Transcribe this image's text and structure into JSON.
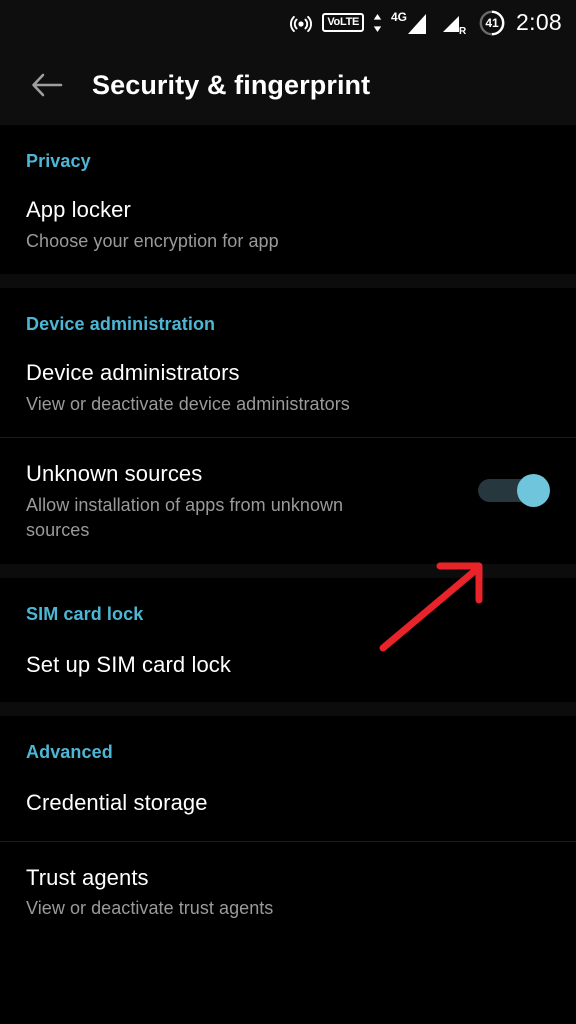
{
  "status_bar": {
    "icons": [
      "hotspot-icon",
      "volte-icon",
      "data-transfer-icon",
      "signal-4g-icon",
      "signal-roaming-icon",
      "battery-icon"
    ],
    "volte_label": "VoLTE",
    "network_label": "4G",
    "roaming_label": "R",
    "battery_level": "41",
    "time": "2:08"
  },
  "app_bar": {
    "back_icon": "back-arrow-icon",
    "title": "Security & fingerprint"
  },
  "colors": {
    "accent": "#4db6d4",
    "background": "#000000",
    "bar_background": "#0e0e0e",
    "primary_text": "#ffffff",
    "secondary_text": "#9a9a9a",
    "toggle_track_on": "#26383d",
    "toggle_thumb_on": "#6fc5dc",
    "annotation": "#e8232a"
  },
  "sections": [
    {
      "header": "Privacy",
      "rows": [
        {
          "title": "App locker",
          "subtitle": "Choose your encryption for app",
          "control": "none"
        }
      ]
    },
    {
      "header": "Device administration",
      "rows": [
        {
          "title": "Device administrators",
          "subtitle": "View or deactivate device administrators",
          "control": "none"
        },
        {
          "title": "Unknown sources",
          "subtitle": "Allow installation of apps from unknown sources",
          "control": "toggle",
          "toggle_state": "on"
        }
      ]
    },
    {
      "header": "SIM card lock",
      "rows": [
        {
          "title": "Set up SIM card lock",
          "subtitle": "",
          "control": "none"
        }
      ]
    },
    {
      "header": "Advanced",
      "rows": [
        {
          "title": "Credential storage",
          "subtitle": "",
          "control": "none"
        },
        {
          "title": "Trust agents",
          "subtitle": "View or deactivate trust agents",
          "control": "none"
        }
      ]
    }
  ],
  "annotation": {
    "type": "arrow",
    "points_to": "unknown-sources-toggle",
    "color": "#e8232a"
  }
}
